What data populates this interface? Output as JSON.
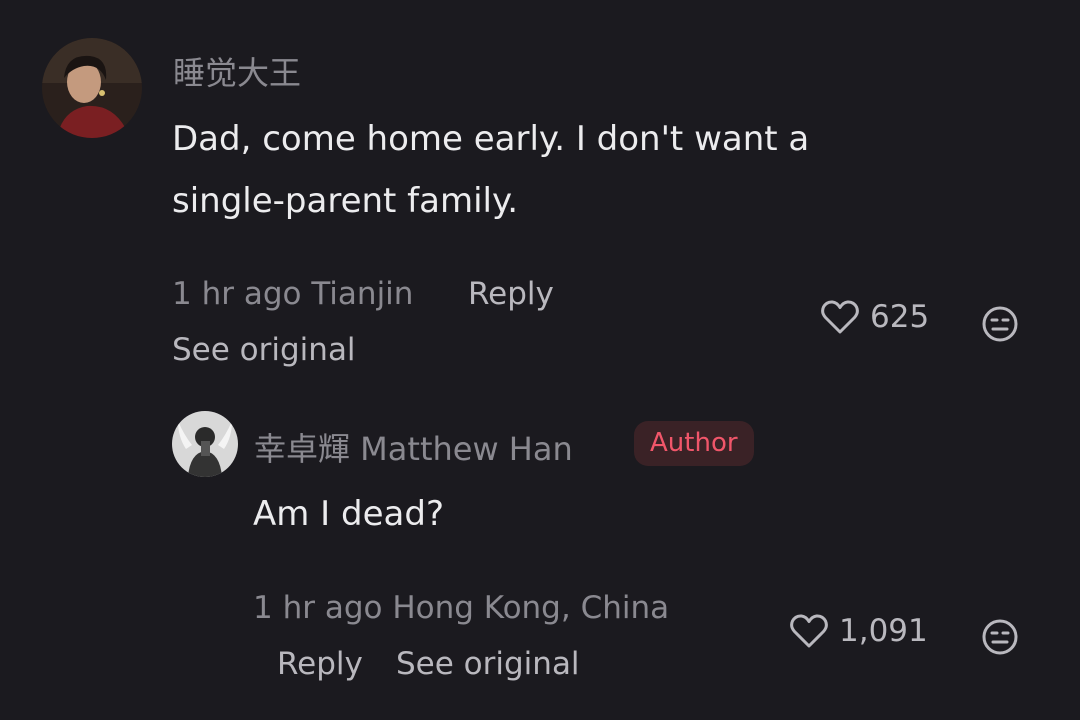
{
  "comments": [
    {
      "username": "睡觉大王",
      "text_lines": [
        "Dad, come home early. I don't want a",
        "single-parent family."
      ],
      "time": "1 hr ago",
      "location": "Tianjin",
      "reply_label": "Reply",
      "see_original_label": "See original",
      "likes": "625",
      "avatar_icon": "user-photo-avatar",
      "like_icon": "heart-outline-icon",
      "dislike_icon": "neutral-face-icon"
    },
    {
      "username": "幸卓輝 Matthew Han",
      "badge": "Author",
      "text_lines": [
        "Am I dead?"
      ],
      "time": "1 hr ago",
      "location": "Hong Kong, China",
      "reply_label": "Reply",
      "see_original_label": "See original",
      "likes": "1,091",
      "avatar_icon": "user-photo-avatar",
      "like_icon": "heart-outline-icon",
      "dislike_icon": "neutral-face-icon"
    }
  ],
  "colors": {
    "background": "#1b1a1f",
    "text": "#ececee",
    "muted": "#8a8990",
    "action": "#b9b8be",
    "badge_text": "#f0566a",
    "badge_bg": "#3a2226"
  }
}
